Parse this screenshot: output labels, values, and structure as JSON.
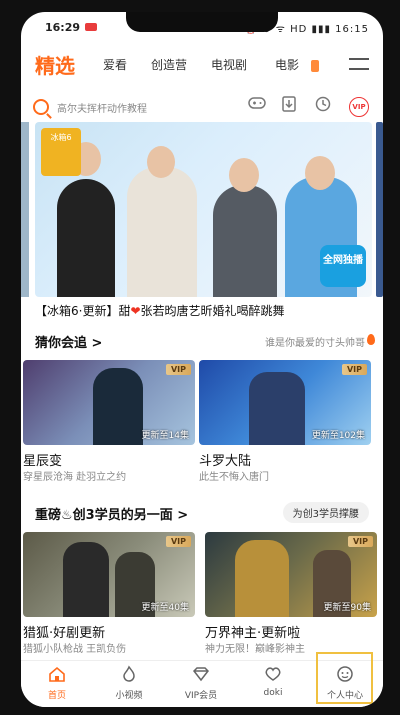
{
  "status_bar": {
    "time": "16:29",
    "right": "⏰ ⊘ ᯤ HD ▮▮▮ 16:15"
  },
  "top_nav": {
    "tabs": [
      "精选",
      "爱看",
      "创造营",
      "电视剧",
      "电影"
    ]
  },
  "search": {
    "placeholder": "高尔夫挥杆动作教程",
    "vip_label": "VIP"
  },
  "hero": {
    "tag_text": "冰箱6",
    "corner_badge": "全网独播",
    "title_prefix": "【冰箱6·更新】甜",
    "title_suffix": "张若昀唐艺昕婚礼喝醉跳舞"
  },
  "section1": {
    "title": "猜你会追 >",
    "right_text": "谁是你最爱的寸头帅哥",
    "cards": [
      {
        "vip": "VIP",
        "episode": "更新至14集",
        "title": "星辰变",
        "subtitle": "穿星辰沧海 赴羽立之约"
      },
      {
        "vip": "VIP",
        "episode": "更新至102集",
        "title": "斗罗大陆",
        "subtitle": "此生不悔入唐门"
      }
    ]
  },
  "section2": {
    "title": "重磅♨创3学员的另一面 >",
    "pill": "为创3学员撑腰",
    "cards": [
      {
        "vip": "VIP",
        "episode": "更新至40集",
        "title": "猎狐·好剧更新",
        "subtitle": "猎狐小队枪战 王凯负伤"
      },
      {
        "vip": "VIP",
        "episode": "更新至90集",
        "title": "万界神主·更新啦",
        "subtitle": "神力无限！巅峰影神主"
      }
    ]
  },
  "bottom_nav": [
    {
      "label": "首页",
      "icon": "home-icon",
      "active": true
    },
    {
      "label": "小视频",
      "icon": "flame-icon",
      "active": false
    },
    {
      "label": "VIP会员",
      "icon": "diamond-icon",
      "active": false
    },
    {
      "label": "doki",
      "icon": "doki-heart-icon",
      "active": false
    },
    {
      "label": "个人中心",
      "icon": "profile-icon",
      "active": false
    }
  ],
  "colors": {
    "accent": "#ff6a1a",
    "highlight": "#f0c040",
    "vip_gold": "#d9a85a"
  }
}
